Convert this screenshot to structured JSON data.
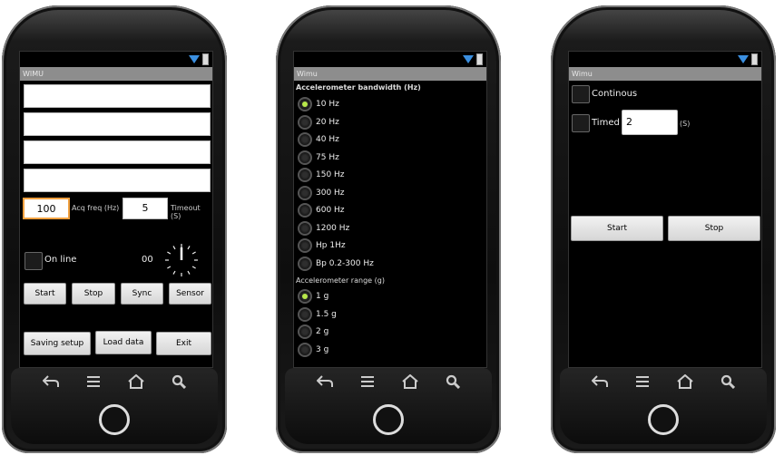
{
  "screens": [
    {
      "title": "WIMU",
      "acq_freq_value": "100",
      "acq_freq_label": "Acq freq (Hz)",
      "timeout_value": "5",
      "timeout_label": "Timeout (S)",
      "online_label": "On line",
      "counter": "00",
      "buttons_row1": [
        "Start",
        "Stop",
        "Sync",
        "Sensor"
      ],
      "buttons_row2": [
        "Saving setup",
        "Load data",
        "Exit"
      ]
    },
    {
      "title": "Wimu",
      "bandwidth_header": "Accelerometer bandwidth (Hz)",
      "bandwidth_options": [
        "10 Hz",
        "20 Hz",
        "40 Hz",
        "75 Hz",
        "150 Hz",
        "300 Hz",
        "600 Hz",
        "1200 Hz",
        "Hp 1Hz",
        "Bp 0.2-300 Hz"
      ],
      "bandwidth_selected": "10 Hz",
      "range_header": "Accelerometer range (g)",
      "range_options": [
        "1 g",
        "1.5 g",
        "2 g",
        "3 g"
      ],
      "range_selected": "1 g"
    },
    {
      "title": "Wimu",
      "continous_label": "Continous",
      "timed_label": "Timed",
      "timed_value": "2",
      "timed_unit": "(S)",
      "start_label": "Start",
      "stop_label": "Stop"
    }
  ],
  "icons": {
    "status": [
      "signal-icon",
      "battery-icon"
    ],
    "nav": [
      "back-icon",
      "menu-icon",
      "home-icon",
      "search-icon"
    ]
  },
  "colors": {
    "titlebar": "#8d8d8d",
    "radio_selected": "#b7e84a",
    "signal": "#3b8fe0",
    "input_focus": "#f0a040"
  }
}
